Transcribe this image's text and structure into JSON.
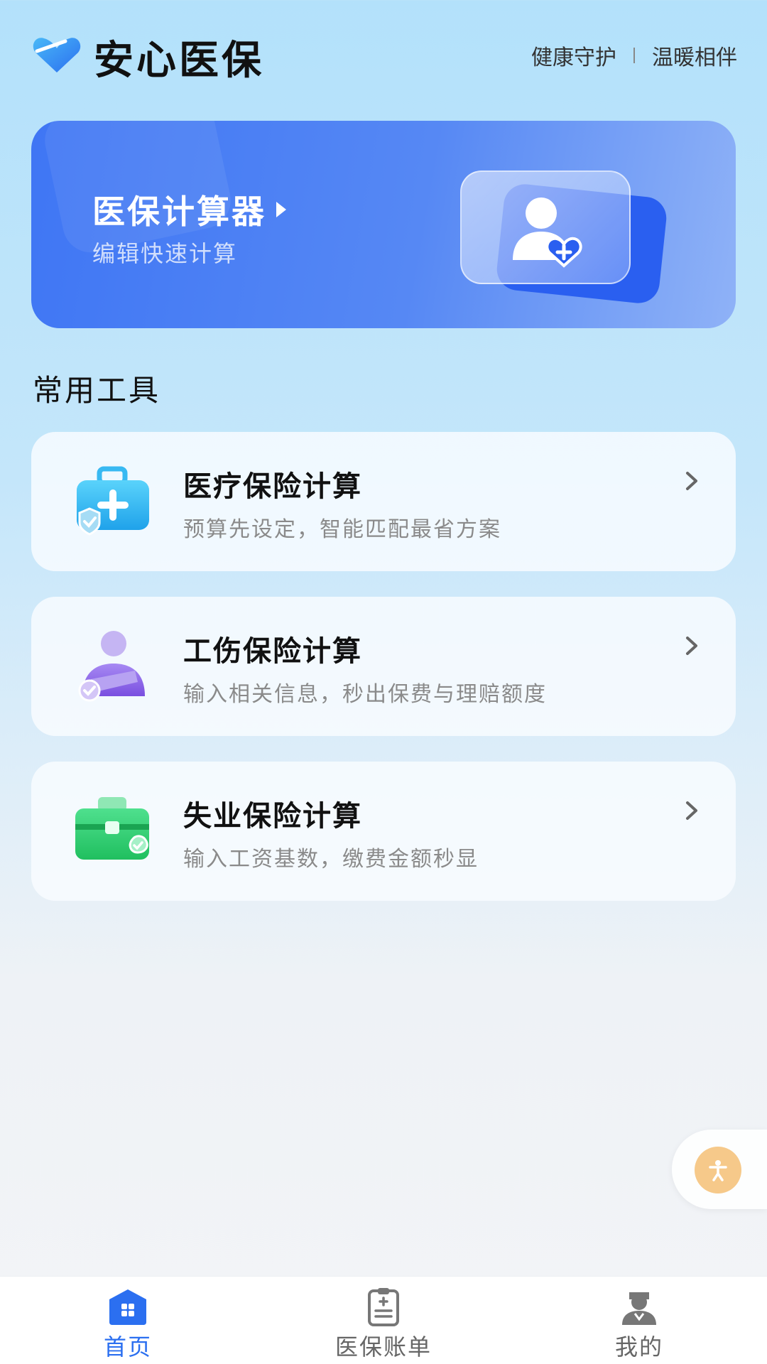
{
  "header": {
    "app_title": "安心医保",
    "slogan_left": "健康守护",
    "slogan_right": "温暖相伴"
  },
  "banner": {
    "title": "医保计算器",
    "subtitle": "编辑快速计算",
    "icon": "user-plus-heart-icon"
  },
  "section": {
    "title": "常用工具"
  },
  "tools": [
    {
      "name": "医疗保险计算",
      "desc": "预算先设定，智能匹配最省方案",
      "icon": "medical-kit-icon"
    },
    {
      "name": "工伤保险计算",
      "desc": "输入相关信息，秒出保费与理赔额度",
      "icon": "injured-person-icon"
    },
    {
      "name": "失业保险计算",
      "desc": "输入工资基数，缴费金额秒显",
      "icon": "briefcase-icon"
    }
  ],
  "tabbar": {
    "items": [
      {
        "label": "首页",
        "icon": "home-icon",
        "active": true
      },
      {
        "label": "医保账单",
        "icon": "clipboard-icon",
        "active": false
      },
      {
        "label": "我的",
        "icon": "doctor-icon",
        "active": false
      }
    ]
  },
  "colors": {
    "accent": "#2b6ff0",
    "banner_start": "#3f76f4",
    "tool1": "#2fb4ef",
    "tool2": "#8a63e8",
    "tool3": "#2ecb6e",
    "assist": "#f6c98a"
  }
}
